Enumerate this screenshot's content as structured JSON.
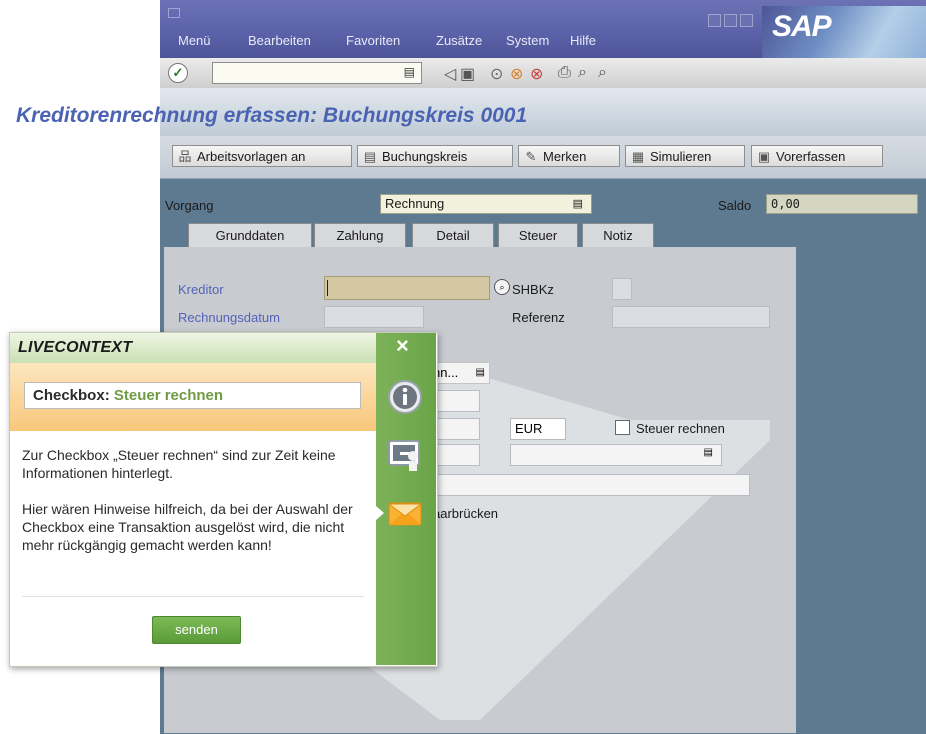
{
  "menu": {
    "items": [
      "Menü",
      "Bearbeiten",
      "Favoriten",
      "Zusätze",
      "System",
      "Hilfe"
    ],
    "logo": "SAP"
  },
  "toolbar": {
    "command_value": "",
    "ok_icon": "check-icon"
  },
  "screen": {
    "title": "Kreditorenrechnung erfassen: Buchungskreis 0001"
  },
  "app_toolbar": {
    "buttons": [
      "Arbeitsvorlagen an",
      "Buchungskreis",
      "Merken",
      "Simulieren",
      "Vorerfassen"
    ]
  },
  "header": {
    "vorgang_label": "Vorgang",
    "vorgang_value": "Rechnung",
    "saldo_label": "Saldo",
    "saldo_value": "0,00"
  },
  "tabs": [
    "Grunddaten",
    "Zahlung",
    "Detail",
    "Steuer",
    "Notiz"
  ],
  "form": {
    "kreditor_label": "Kreditor",
    "shbkz_label": "SHBKz",
    "rechnungsdatum_label": "Rechnungsdatum",
    "referenz_label": "Referenz",
    "partial_dropdown": "hn...",
    "currency": "EUR",
    "steuer_label": "Steuer rechnen",
    "partial_text": "aarbrücken"
  },
  "livecontext": {
    "title": "LIVECONTEXT",
    "close": "×",
    "context_key": "Checkbox:",
    "context_value": "Steuer rechnen",
    "paragraph1": "Zur Checkbox „Steuer rechnen“ sind zur Zeit keine Informationen hinterlegt.",
    "paragraph2": "Hier wären Hinweise hilfreich, da bei der Auswahl der Checkbox eine Transaktion ausgelöst wird, die nicht mehr rückgängig gemacht werden kann!",
    "send_button": "senden",
    "sidebar_icons": [
      "info-icon",
      "presentation-icon",
      "mail-icon"
    ]
  }
}
